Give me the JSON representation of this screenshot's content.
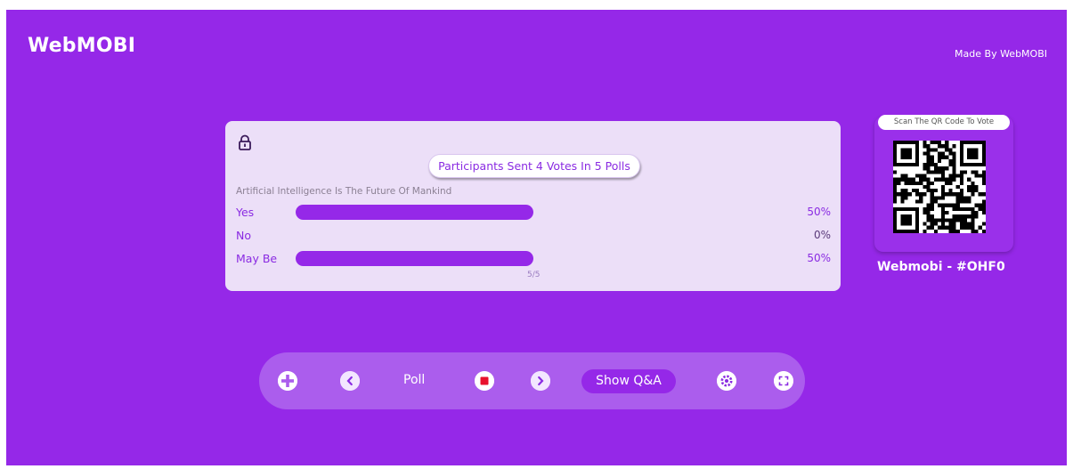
{
  "header": {
    "brand": "WebMOBI",
    "credit": "Made By WebMOBI"
  },
  "poll": {
    "summary": "Participants Sent 4 Votes In 5 Polls",
    "question": "Artificial Intelligence Is The Future Of Mankind",
    "options": [
      {
        "label": "Yes",
        "percent_text": "50%",
        "fraction": 0.5
      },
      {
        "label": "No",
        "percent_text": "0%",
        "fraction": 0
      },
      {
        "label": "May Be",
        "percent_text": "50%",
        "fraction": 0.5
      }
    ],
    "pager": "5/5",
    "lock_icon": "lock-icon"
  },
  "qr": {
    "caption": "Scan The QR Code To Vote",
    "session_code": "Webmobi - #OHF0"
  },
  "toolbar": {
    "poll_label": "Poll",
    "qa_label": "Show Q&A",
    "icons": [
      "add-icon",
      "previous-icon",
      "stop-icon",
      "next-icon",
      "settings-icon",
      "fullscreen-icon"
    ]
  },
  "colors": {
    "background": "#9528e8",
    "card": "#ecdff8",
    "bar": "#9528e8",
    "text_accent": "#8a2be2",
    "stop_red": "#e8112d"
  }
}
